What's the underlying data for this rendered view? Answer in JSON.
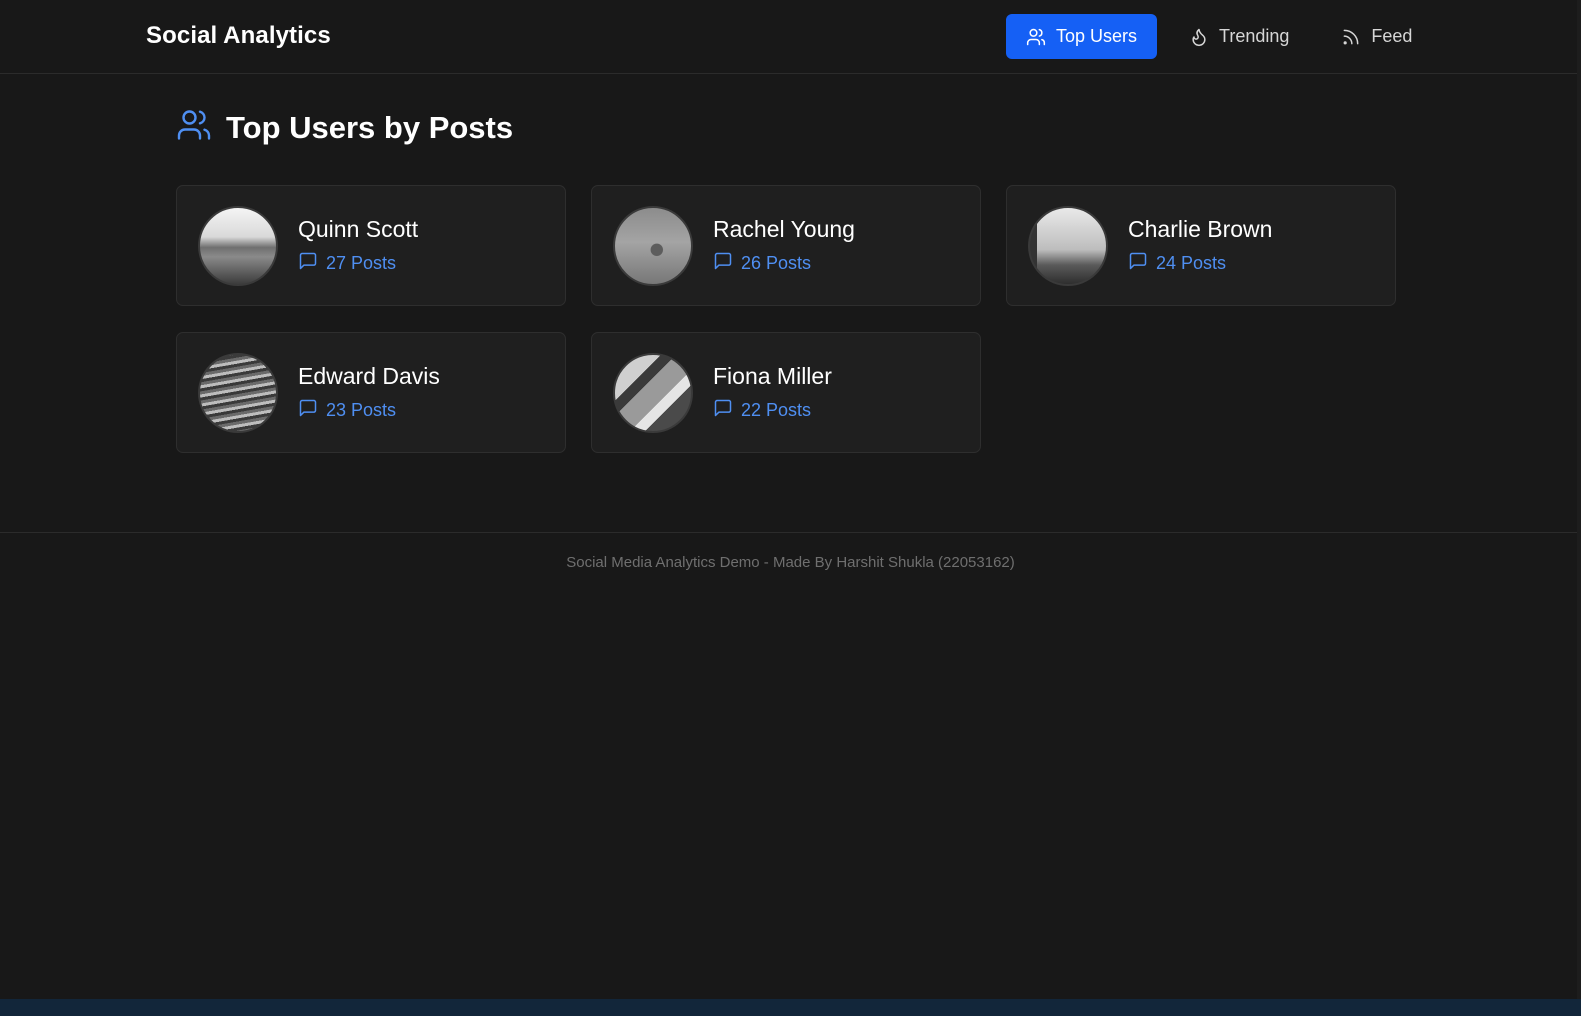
{
  "app": {
    "title": "Social Analytics"
  },
  "nav": {
    "items": [
      {
        "label": "Top Users",
        "icon": "users-icon",
        "active": true
      },
      {
        "label": "Trending",
        "icon": "flame-icon",
        "active": false
      },
      {
        "label": "Feed",
        "icon": "rss-icon",
        "active": false
      }
    ]
  },
  "main": {
    "title": "Top Users by Posts",
    "title_icon": "users-icon",
    "users": [
      {
        "name": "Quinn Scott",
        "posts": "27 Posts"
      },
      {
        "name": "Rachel Young",
        "posts": "26 Posts"
      },
      {
        "name": "Charlie Brown",
        "posts": "24 Posts"
      },
      {
        "name": "Edward Davis",
        "posts": "23 Posts"
      },
      {
        "name": "Fiona Miller",
        "posts": "22 Posts"
      }
    ]
  },
  "footer": {
    "text": "Social Media Analytics Demo - Made By Harshit Shukla (22053162)"
  },
  "colors": {
    "background": "#181818",
    "card": "#1f1f1f",
    "accent": "#1560f5",
    "link": "#4f8ff2",
    "text": "#ffffff",
    "muted": "#6f6f6f"
  }
}
